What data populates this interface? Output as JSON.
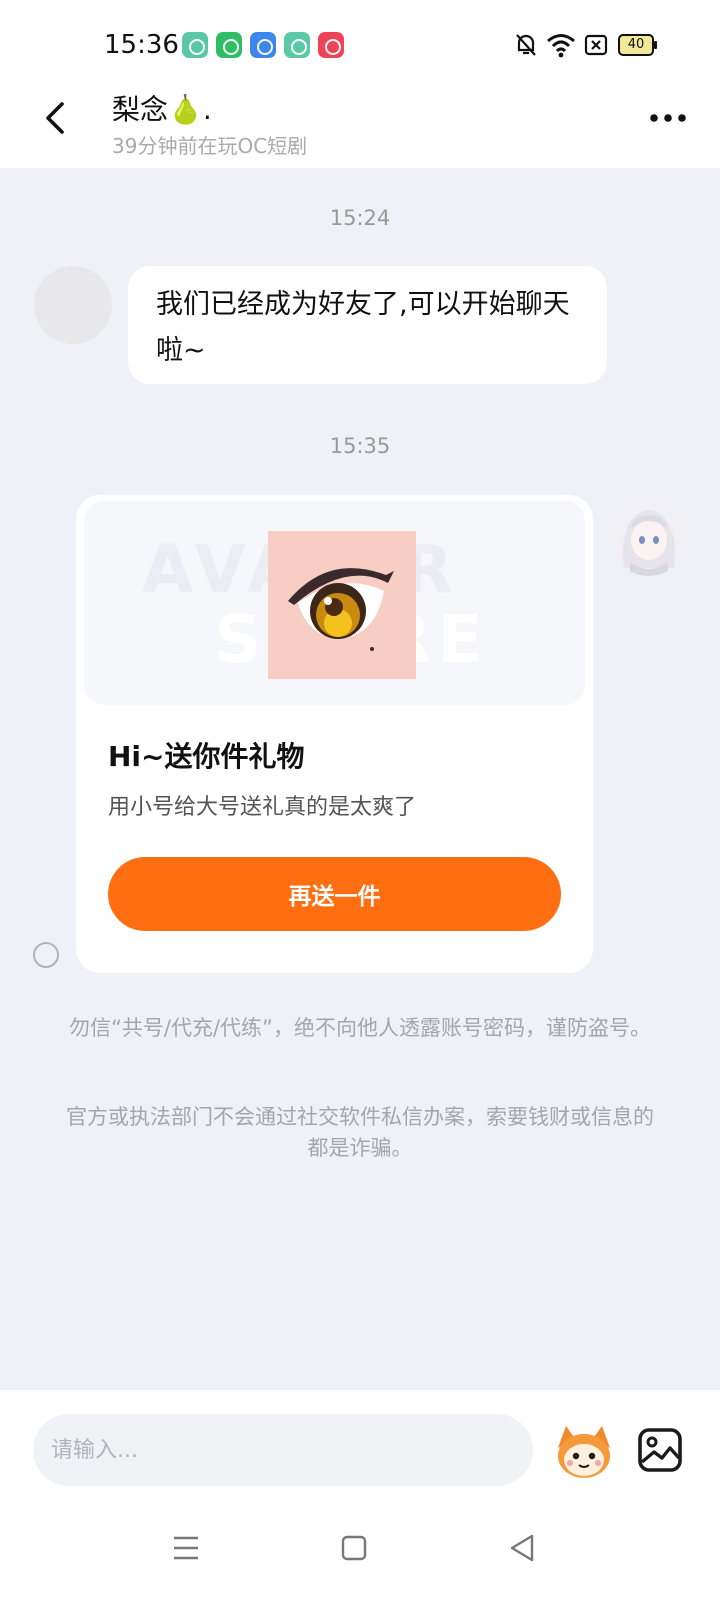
{
  "status_bar": {
    "time": "15:36",
    "battery": "40",
    "app_icons": [
      {
        "name": "dollar-app-icon",
        "color": "#58c9a4"
      },
      {
        "name": "shield-app-icon",
        "color": "#2fbe63"
      },
      {
        "name": "link-app-icon",
        "color": "#3d86ef"
      },
      {
        "name": "upload-app-icon",
        "color": "#5cc9a6"
      },
      {
        "name": "video-app-icon",
        "color": "#ef4455"
      }
    ]
  },
  "header": {
    "contact_name": "梨念🍐.",
    "contact_status": "39分钟前在玩OC短剧"
  },
  "chat": {
    "timestamp_1": "15:24",
    "message_1": "我们已经成为好友了,可以开始聊天啦~",
    "timestamp_2": "15:35",
    "gift_card": {
      "watermark_line_1": "AVATAR",
      "watermark_line_2": "STORE",
      "title": "Hi~送你件礼物",
      "description": "用小号给大号送礼真的是太爽了",
      "button_label": "再送一件"
    },
    "notice_1": "勿信“共号/代充/代练”，绝不向他人透露账号密码，谨防盗号。",
    "notice_2": "官方或执法部门不会通过社交软件私信办案，索要钱财或信息的都是诈骗。"
  },
  "input_bar": {
    "placeholder": "请输入..."
  },
  "colors": {
    "accent": "#ff6f12",
    "chat_background": "#eff1f7"
  }
}
